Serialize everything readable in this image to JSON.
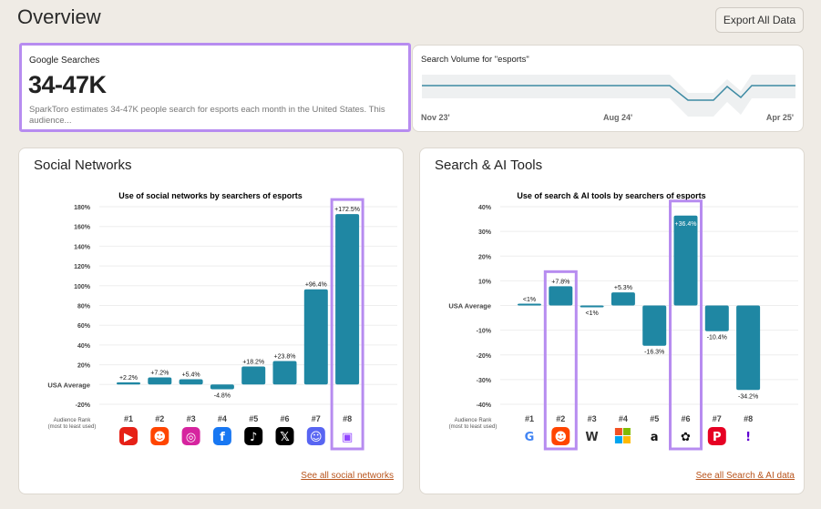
{
  "header": {
    "title": "Overview",
    "export_label": "Export All Data"
  },
  "google_searches": {
    "label": "Google Searches",
    "value": "34-47K",
    "description": "SparkToro estimates 34-47K people search for esports each month in the United States. This audience..."
  },
  "search_volume": {
    "label": "Search Volume for \"esports\"",
    "ticks": [
      "Nov 23'",
      "Aug 24'",
      "Apr 25'"
    ],
    "line_color": "#3d8aa3"
  },
  "social": {
    "heading": "Social Networks",
    "see_all": "See all social networks"
  },
  "search_ai": {
    "heading": "Search & AI Tools",
    "see_all": "See all Search & AI data"
  },
  "colors": {
    "bar": "#1f87a3",
    "highlight": "#b78cf0",
    "link": "#b8541c"
  },
  "chart_data": [
    {
      "type": "bar",
      "title": "Use of social networks by searchers of esports",
      "ylim": [
        -20,
        180
      ],
      "yticks": [
        "180%",
        "160%",
        "140%",
        "120%",
        "100%",
        "80%",
        "60%",
        "40%",
        "20%",
        "USA Average",
        "-20%"
      ],
      "xlabel_title": "Audience Rank",
      "xlabel_sub": "(most to least used)",
      "categories": [
        "#1",
        "#2",
        "#3",
        "#4",
        "#5",
        "#6",
        "#7",
        "#8"
      ],
      "icons": [
        "youtube-icon",
        "reddit-icon",
        "instagram-icon",
        "facebook-icon",
        "tiktok-icon",
        "x-icon",
        "discord-icon",
        "twitch-icon"
      ],
      "values": [
        2.2,
        7.2,
        5.4,
        -4.8,
        18.2,
        23.8,
        96.4,
        172.5
      ],
      "labels": [
        "+2.2%",
        "+7.2%",
        "+5.4%",
        "-4.8%",
        "+18.2%",
        "+23.8%",
        "+96.4%",
        "+172.5%"
      ],
      "highlighted": [
        "#8"
      ]
    },
    {
      "type": "bar",
      "title": "Use of search & AI tools by searchers of esports",
      "ylim": [
        -40,
        40
      ],
      "yticks": [
        "40%",
        "30%",
        "20%",
        "10%",
        "USA Average",
        "-10%",
        "-20%",
        "-30%",
        "-40%"
      ],
      "xlabel_title": "Audience Rank",
      "xlabel_sub": "(most to least used)",
      "categories": [
        "#1",
        "#2",
        "#3",
        "#4",
        "#5",
        "#6",
        "#7",
        "#8"
      ],
      "icons": [
        "google-icon",
        "reddit-icon",
        "wikipedia-icon",
        "microsoft-icon",
        "amazon-icon",
        "chatgpt-icon",
        "pinterest-icon",
        "yahoo-icon"
      ],
      "values": [
        0.5,
        7.8,
        -0.5,
        5.3,
        -16.3,
        36.4,
        -10.4,
        -34.2
      ],
      "labels": [
        "<1%",
        "+7.8%",
        "<1%",
        "+5.3%",
        "-16.3%",
        "+36.4%",
        "-10.4%",
        "-34.2%"
      ],
      "highlighted": [
        "#2",
        "#6"
      ]
    }
  ]
}
